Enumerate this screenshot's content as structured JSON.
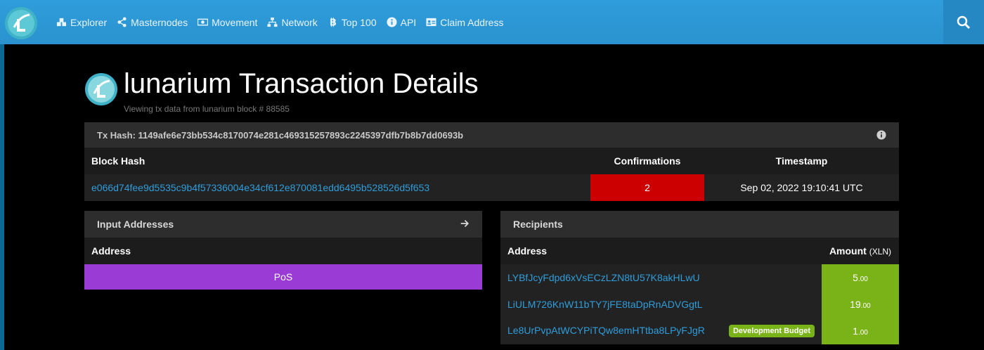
{
  "nav": {
    "items": [
      {
        "label": "Explorer",
        "icon": "cubes-icon"
      },
      {
        "label": "Masternodes",
        "icon": "share-icon"
      },
      {
        "label": "Movement",
        "icon": "money-icon"
      },
      {
        "label": "Network",
        "icon": "sitemap-icon"
      },
      {
        "label": "Top 100",
        "icon": "bitcoin-icon"
      },
      {
        "label": "API",
        "icon": "info-circle-icon"
      },
      {
        "label": "Claim Address",
        "icon": "address-card-icon"
      }
    ]
  },
  "page": {
    "title": "lunarium Transaction Details",
    "subtitle": "Viewing tx data from lunarium block # 88585"
  },
  "tx": {
    "hash_label": "Tx Hash: 1149afe6e73bb534c8170074e281c469315257893c2245397dfb7b8b7dd0693b",
    "headers": {
      "block_hash": "Block Hash",
      "confirmations": "Confirmations",
      "timestamp": "Timestamp"
    },
    "block_hash": "e066d74fee9d5535c9b4f57336004e34cf612e870081edd6495b528526d5f653",
    "confirmations": "2",
    "timestamp": "Sep 02, 2022 19:10:41 UTC"
  },
  "inputs": {
    "title": "Input Addresses",
    "address_header": "Address",
    "rows": [
      "PoS"
    ]
  },
  "recipients": {
    "title": "Recipients",
    "address_header": "Address",
    "amount_header": "Amount",
    "amount_unit": "(XLN)",
    "rows": [
      {
        "address": "LYBfJcyFdpd6xVsECzLZN8tU57K8akHLwU",
        "badge": "",
        "amount_int": "5",
        "amount_dec": ".00"
      },
      {
        "address": "LiULM726KnW11bTY7jFE8taDpRnADVGgtL",
        "badge": "",
        "amount_int": "19",
        "amount_dec": ".00"
      },
      {
        "address": "Le8UrPvpAtWCYPiTQw8emHTtba8LPyFJgR",
        "badge": "Development Budget",
        "amount_int": "1",
        "amount_dec": ".00"
      }
    ]
  },
  "colors": {
    "navbar": "#2f9ddb",
    "confirmations_bg": "#cc0000",
    "pos_bg": "#9b3bd5",
    "amount_bg": "#7ab317",
    "link": "#2f9ddb"
  }
}
